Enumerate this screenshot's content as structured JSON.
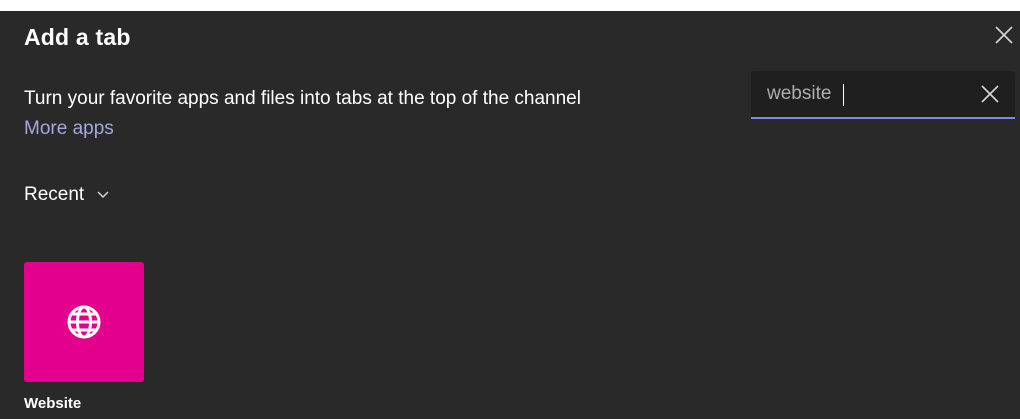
{
  "dialog": {
    "title": "Add a tab",
    "subtitle": "Turn your favorite apps and files into tabs at the top of the channel",
    "more_apps_label": "More apps",
    "close_icon": "close-icon"
  },
  "search": {
    "value": "website",
    "clear_icon": "close-icon",
    "accent_color": "#7f85f5"
  },
  "section": {
    "label": "Recent",
    "chevron_icon": "chevron-down-icon"
  },
  "apps": [
    {
      "name": "Website",
      "icon": "globe-icon",
      "tile_color": "#e3008c"
    }
  ],
  "colors": {
    "background": "#292929",
    "link": "#a6a7dc",
    "search_bg": "#1f1f1f"
  }
}
